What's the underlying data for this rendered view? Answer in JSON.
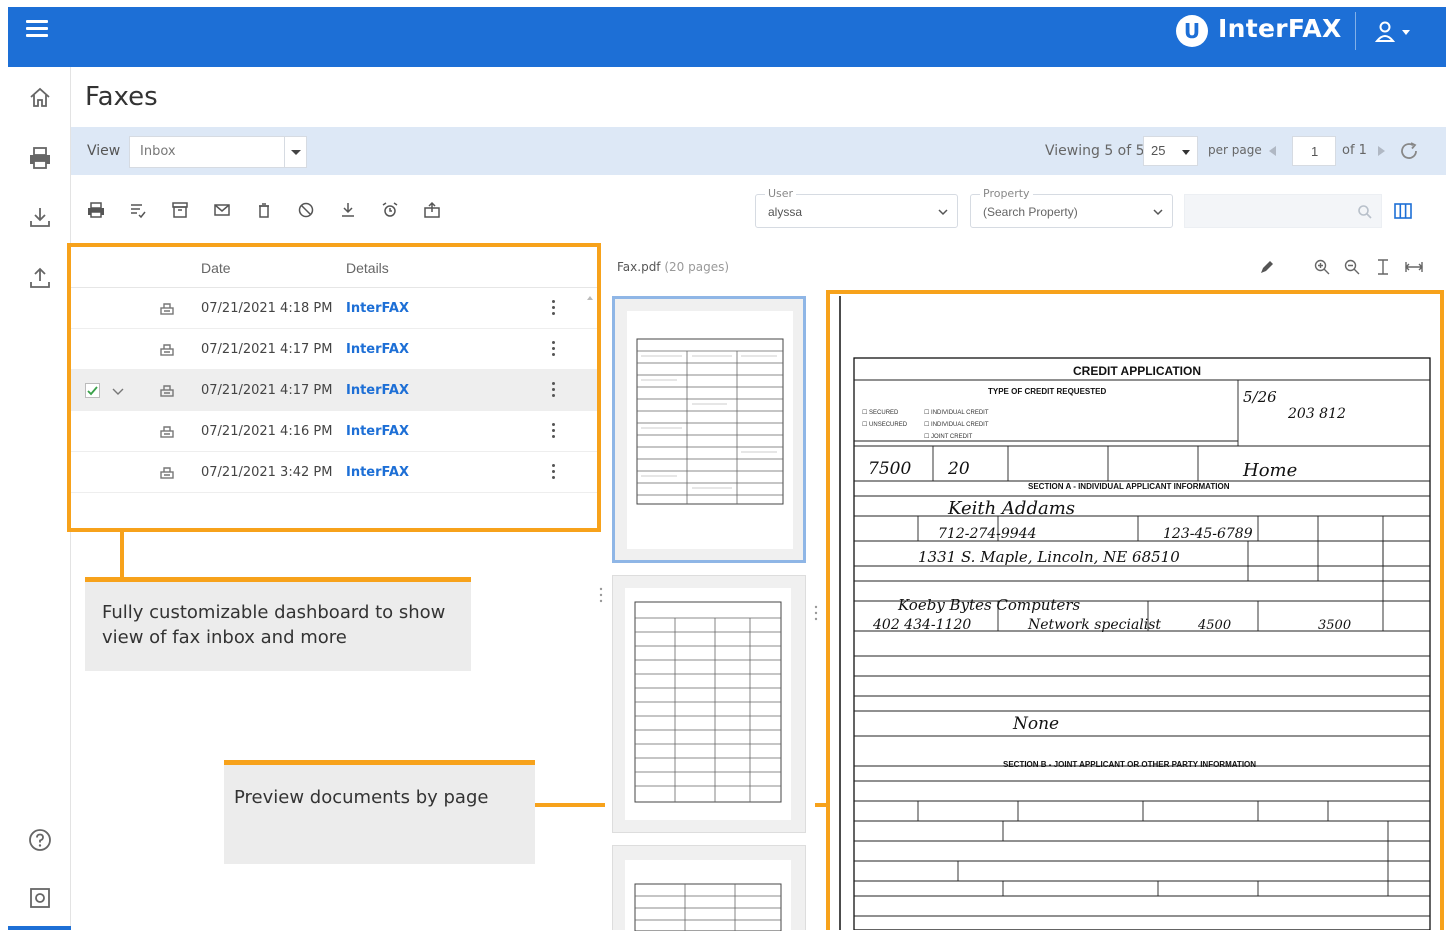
{
  "app": {
    "logo_mark": "U",
    "logo_text": "InterFAX",
    "brand_color": "#1d6fd6",
    "accent_color": "#f7a21b"
  },
  "page_title": "Faxes",
  "viewbar": {
    "view_label": "View",
    "view_value": "Inbox",
    "viewing_text": "Viewing 5 of 5",
    "per_page_value": "25",
    "per_page_label": "per page",
    "page_number": "1",
    "page_total": "of 1"
  },
  "filters": {
    "user_label": "User",
    "user_value": "alyssa",
    "property_label": "Property",
    "property_value": "(Search Property)",
    "search_placeholder": ""
  },
  "toolbar_icons": [
    "print-icon",
    "mark-read-icon",
    "archive-icon",
    "email-icon",
    "delete-icon",
    "block-icon",
    "download-icon",
    "alarm-icon",
    "export-icon"
  ],
  "table": {
    "columns": [
      "Date",
      "Details"
    ],
    "rows": [
      {
        "date": "07/21/2021 4:18 PM",
        "details": "InterFAX",
        "selected": false
      },
      {
        "date": "07/21/2021 4:17 PM",
        "details": "InterFAX",
        "selected": false
      },
      {
        "date": "07/21/2021 4:17 PM",
        "details": "InterFAX",
        "selected": true
      },
      {
        "date": "07/21/2021 4:16 PM",
        "details": "InterFAX",
        "selected": false
      },
      {
        "date": "07/21/2021 3:42 PM",
        "details": "InterFAX",
        "selected": false
      }
    ]
  },
  "preview": {
    "file_name": "Fax.pdf",
    "page_count": "(20 pages)"
  },
  "document": {
    "title": "CREDIT APPLICATION",
    "type_header": "TYPE OF CREDIT REQUESTED",
    "section_a": "SECTION A - INDIVIDUAL APPLICANT INFORMATION",
    "section_b": "SECTION B - JOINT APPLICANT OR OTHER PARTY INFORMATION",
    "hw_amount": "7500",
    "hw_term": "20",
    "hw_purpose": "Home",
    "hw_name": "Keith Addams",
    "hw_phone": "712-274-9944",
    "hw_ssn": "123-45-6789",
    "hw_address": "1331 S. Maple, Lincoln, NE 68510",
    "hw_employer": "Koeby Bytes Computers",
    "hw_biz_phone": "402 434-1120",
    "hw_position": "Network specialist",
    "hw_salary": "4500",
    "hw_net": "3500",
    "hw_other": "None",
    "hw_date": "5/26",
    "hw_account": "203 812"
  },
  "callouts": {
    "dashboard": "Fully customizable dashboard to show view of fax inbox and more",
    "preview": "Preview documents by page"
  }
}
